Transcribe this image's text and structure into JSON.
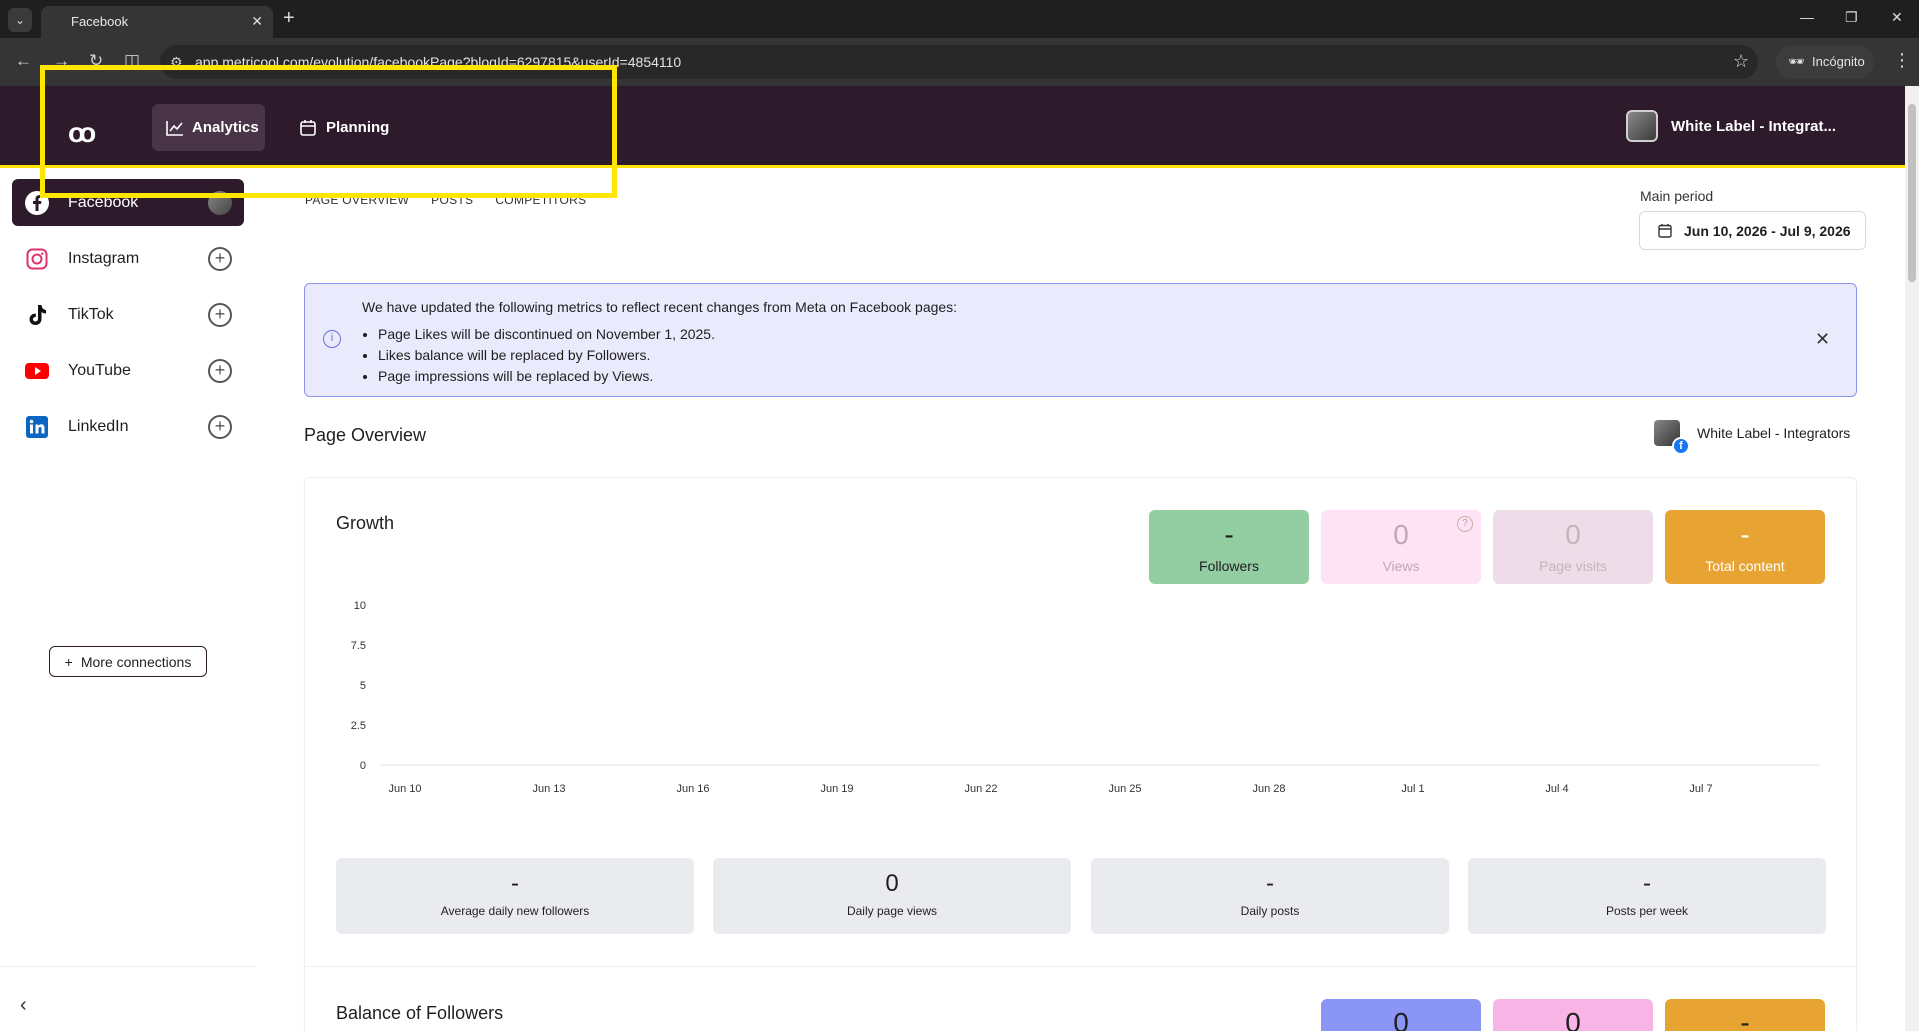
{
  "browser": {
    "tab_title": "Facebook",
    "url": "app.metricool.com/evolution/facebookPage?blogId=6297815&userId=4854110",
    "incognito_label": "Incógnito"
  },
  "header": {
    "nav": [
      {
        "label": "Analytics",
        "icon": "chart-line-icon"
      },
      {
        "label": "Planning",
        "icon": "calendar-icon"
      }
    ],
    "account_name": "White Label - Integrat..."
  },
  "sidebar": {
    "items": [
      {
        "label": "Facebook",
        "icon": "facebook-icon",
        "color": "#1877f2"
      },
      {
        "label": "Instagram",
        "icon": "instagram-icon",
        "color": "#e1306c"
      },
      {
        "label": "TikTok",
        "icon": "tiktok-icon",
        "color": "#000000"
      },
      {
        "label": "YouTube",
        "icon": "youtube-icon",
        "color": "#ff0000"
      },
      {
        "label": "LinkedIn",
        "icon": "linkedin-icon",
        "color": "#0a66c2"
      }
    ],
    "more_connections": "More connections"
  },
  "subtabs": [
    "PAGE OVERVIEW",
    "POSTS",
    "COMPETITORS"
  ],
  "period": {
    "label": "Main period",
    "value": "Jun 10, 2026 - Jul 9, 2026"
  },
  "notice": {
    "title": "We have updated the following metrics to reflect recent changes from Meta on Facebook pages:",
    "items": [
      "Page Likes will be discontinued on November 1, 2025.",
      "Likes balance will be replaced by Followers.",
      "Page impressions will be replaced by Views."
    ]
  },
  "overview": {
    "title": "Page Overview",
    "account": "White Label - Integrators"
  },
  "growth": {
    "title": "Growth",
    "metrics": [
      {
        "value": "-",
        "label": "Followers",
        "bg": "#93cda2",
        "fg": "#1f1f1f"
      },
      {
        "value": "0",
        "label": "Views",
        "bg": "#fde3f4",
        "fg": "#c4a4b9"
      },
      {
        "value": "0",
        "label": "Page visits",
        "bg": "#eedde8",
        "fg": "#c4b4be"
      },
      {
        "value": "-",
        "label": "Total content",
        "bg": "#e8a433",
        "fg": "#ffffff"
      }
    ],
    "stats": [
      {
        "value": "-",
        "label": "Average daily new followers"
      },
      {
        "value": "0",
        "label": "Daily page views"
      },
      {
        "value": "-",
        "label": "Daily posts"
      },
      {
        "value": "-",
        "label": "Posts per week"
      }
    ]
  },
  "chart_data": {
    "type": "line",
    "x": [
      "Jun 10",
      "Jun 13",
      "Jun 16",
      "Jun 19",
      "Jun 22",
      "Jun 25",
      "Jun 28",
      "Jul 1",
      "Jul 4",
      "Jul 7"
    ],
    "yticks": [
      "10",
      "7.5",
      "5",
      "2.5",
      "0"
    ],
    "ylim": [
      0,
      10
    ],
    "series": [],
    "grid": false
  },
  "balance": {
    "title": "Balance of Followers",
    "metrics": [
      {
        "value": "0",
        "bg": "#8b95f5"
      },
      {
        "value": "0",
        "bg": "#f8b4e4"
      },
      {
        "value": "-",
        "bg": "#e8a433"
      }
    ]
  }
}
